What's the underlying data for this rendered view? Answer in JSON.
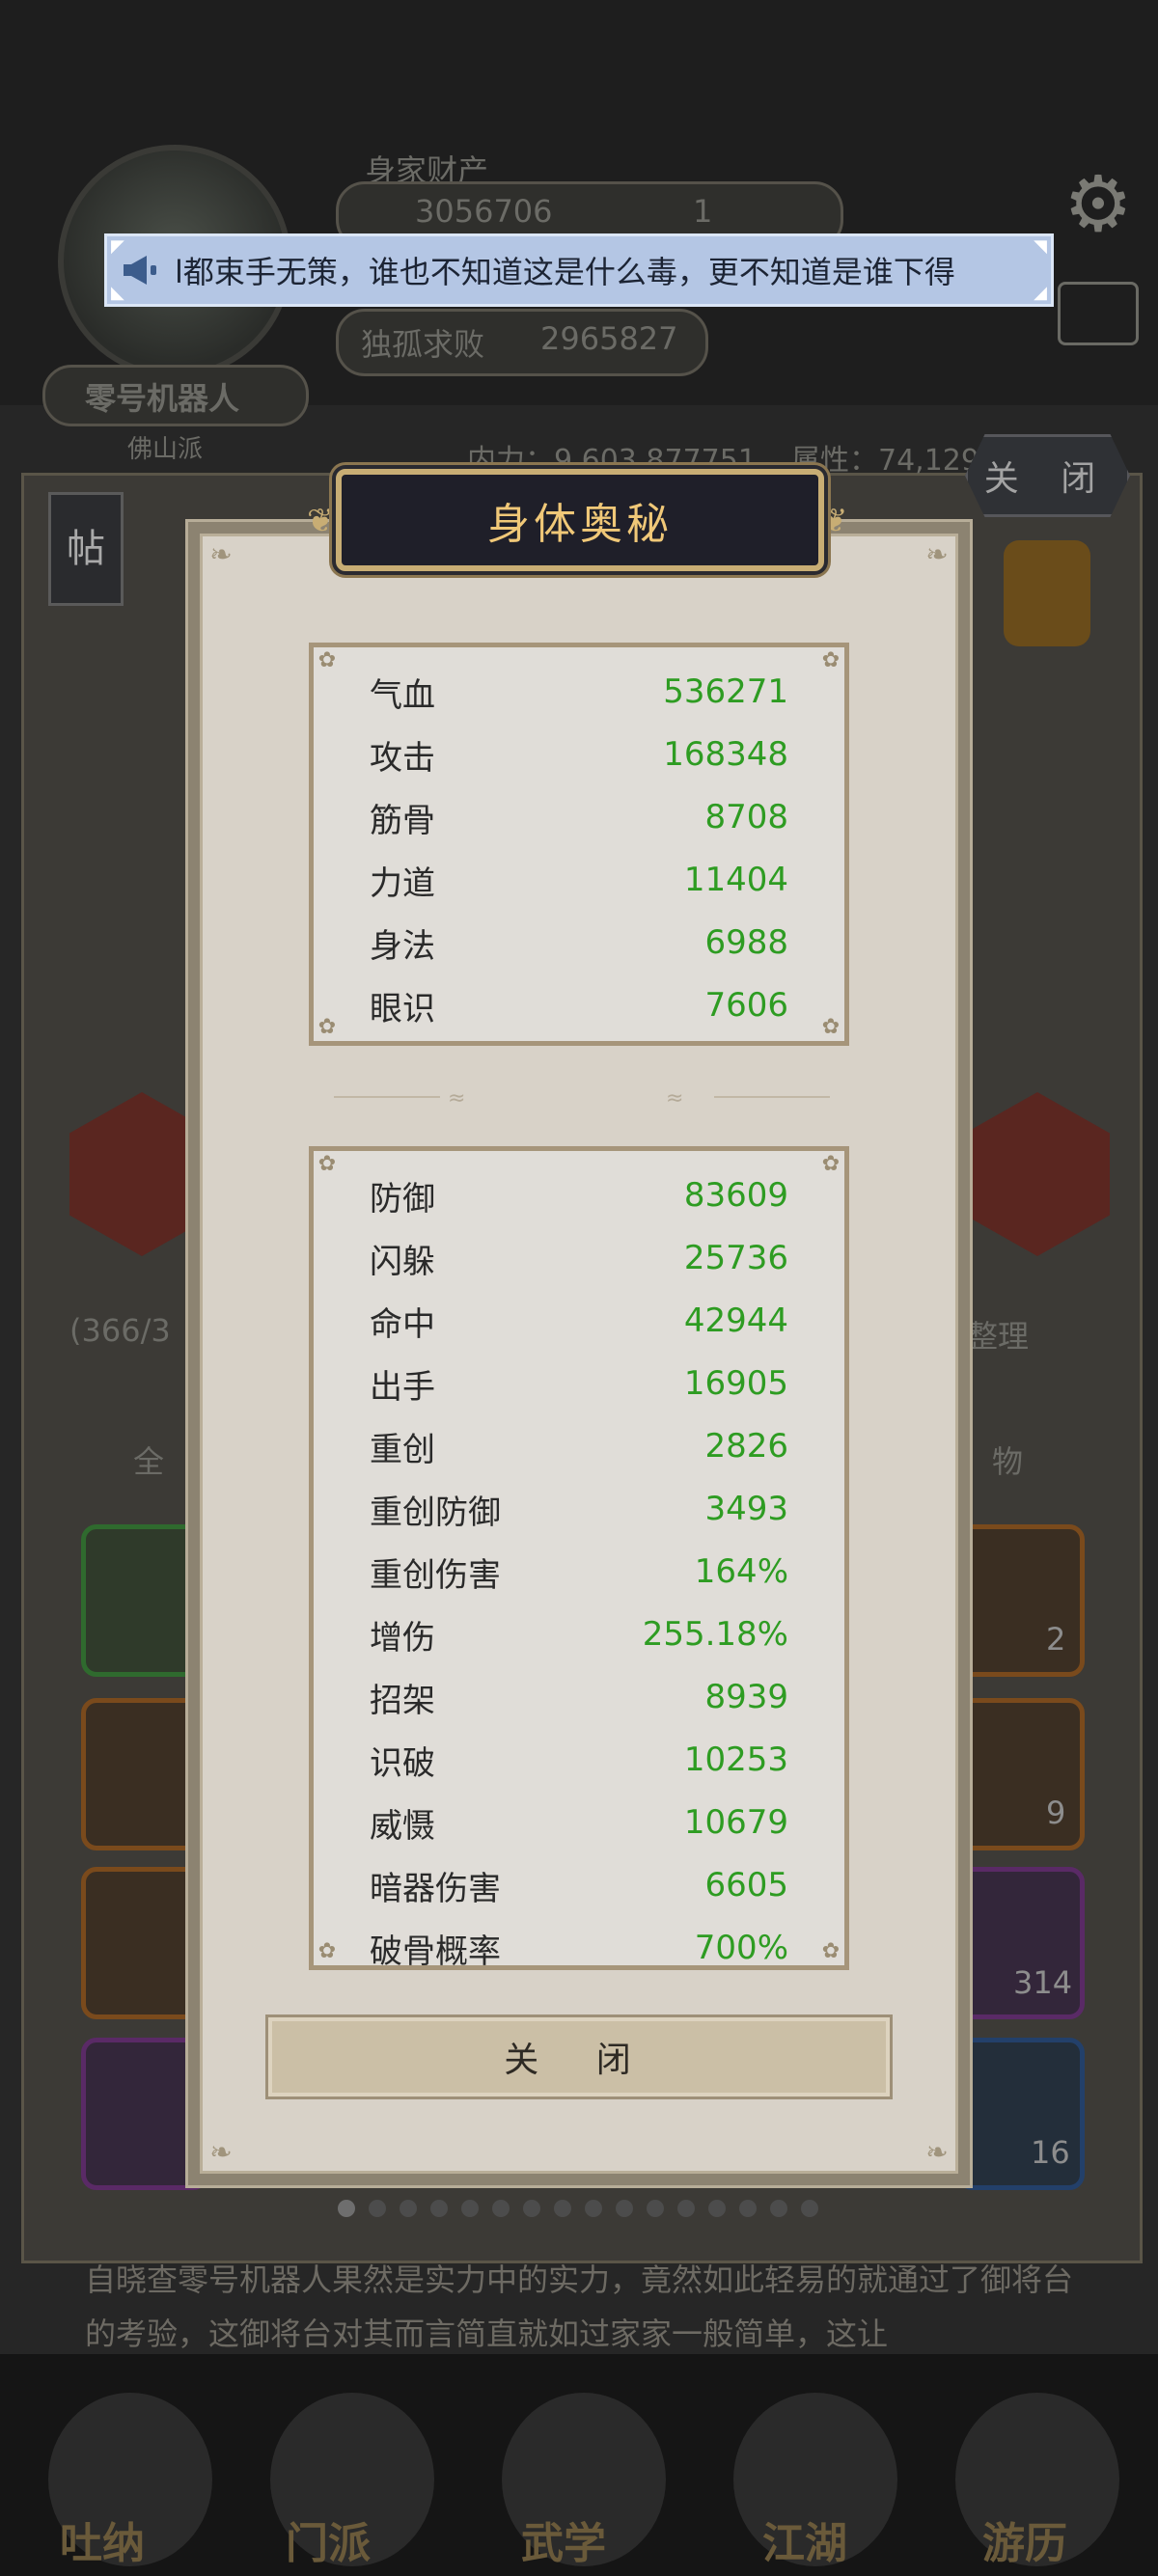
{
  "background": {
    "profile_title": "身家财产",
    "coins": "3056706",
    "tickets": "1",
    "player_name": "零号机器人",
    "sect": "佛山派",
    "arena_title": "独孤求败",
    "arena_score": "2965827",
    "neili": "内力：9,603,877751",
    "attr": "属性：74,129",
    "tie_label": "帖",
    "close_top_label": "关 闭",
    "inventory_count": "(366/3",
    "organize_label": "整理",
    "tab_all": "全",
    "tab_item": "物",
    "slot_counts": [
      "2",
      "9",
      "314",
      "16"
    ],
    "story_text": "自晓查零号机器人果然是实力中的实力，竟然如此轻易的就通过了御将台的考验，这御将台对其而言简直就如过家家一般简单，这让",
    "nav": [
      "吐纳",
      "门派",
      "武学",
      "江湖",
      "游历"
    ]
  },
  "marquee": {
    "text": "l都束手无策，谁也不知道这是什么毒，更不知道是谁下得",
    "icon": "megaphone-icon"
  },
  "modal": {
    "title": "身体奥秘",
    "primary_stats": [
      {
        "label": "气血",
        "value": "536271"
      },
      {
        "label": "攻击",
        "value": "168348"
      },
      {
        "label": "筋骨",
        "value": "8708"
      },
      {
        "label": "力道",
        "value": "11404"
      },
      {
        "label": "身法",
        "value": "6988"
      },
      {
        "label": "眼识",
        "value": "7606"
      }
    ],
    "secondary_stats": [
      {
        "label": "防御",
        "value": "83609"
      },
      {
        "label": "闪躲",
        "value": "25736"
      },
      {
        "label": "命中",
        "value": "42944"
      },
      {
        "label": "出手",
        "value": "16905"
      },
      {
        "label": "重创",
        "value": "2826"
      },
      {
        "label": "重创防御",
        "value": "3493"
      },
      {
        "label": "重创伤害",
        "value": "164%"
      },
      {
        "label": "增伤",
        "value": "255.18%"
      },
      {
        "label": "招架",
        "value": "8939"
      },
      {
        "label": "识破",
        "value": "10253"
      },
      {
        "label": "威慑",
        "value": "10679"
      },
      {
        "label": "暗器伤害",
        "value": "6605"
      },
      {
        "label": "破骨概率",
        "value": "700%"
      }
    ],
    "close_label": "关 闭"
  },
  "pager": {
    "total": 16,
    "active": 0
  },
  "colors": {
    "stat_value": "#2e9c22",
    "title_gold": "#f0c878",
    "marquee_bg": "#b4c6e4"
  }
}
